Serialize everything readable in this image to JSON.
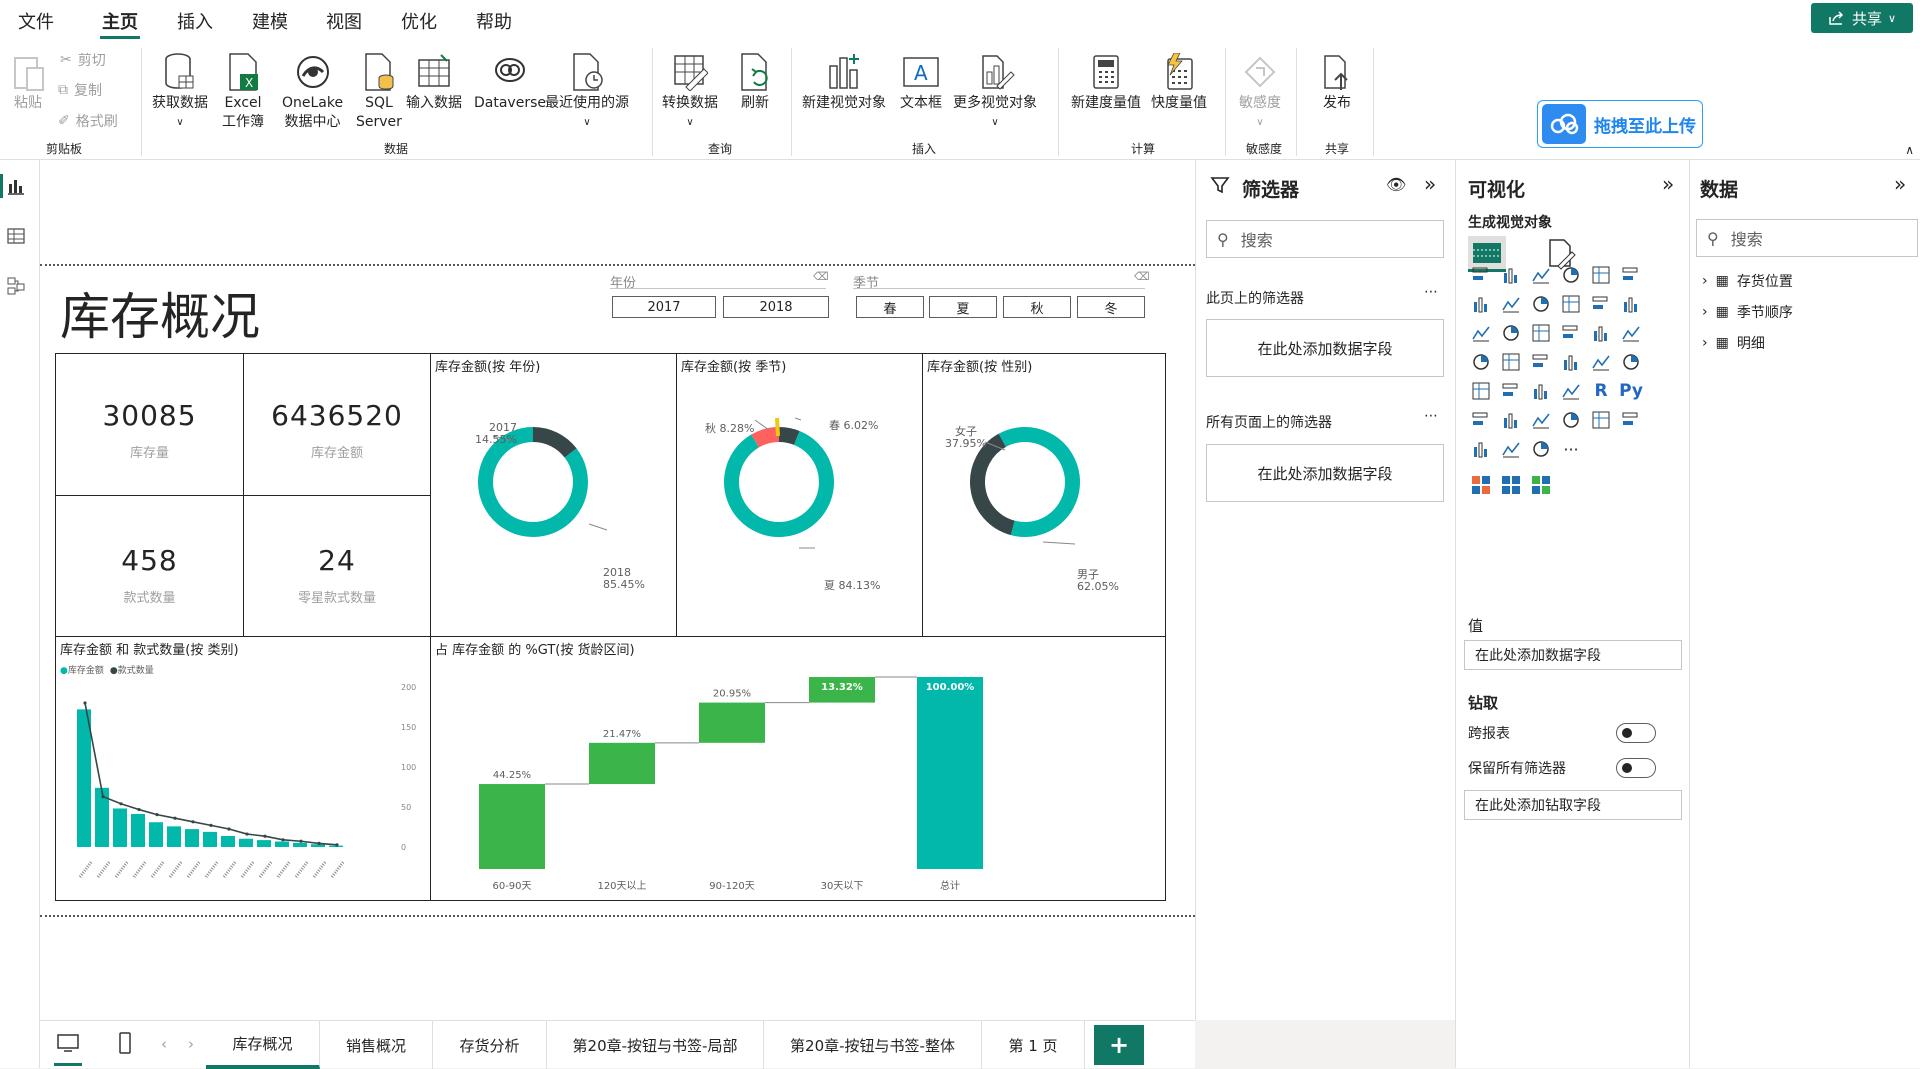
{
  "menu": [
    "文件",
    "主页",
    "插入",
    "建模",
    "视图",
    "优化",
    "帮助"
  ],
  "share": "共享",
  "ribbon": {
    "clipboard": {
      "paste": "粘贴",
      "cut": "剪切",
      "copy": "复制",
      "format": "格式刷",
      "label": "剪贴板"
    },
    "data": {
      "get_data": "获取数据",
      "excel": "Excel\n工作簿",
      "onelake": "OneLake\n数据中心",
      "sql": "SQL\nServer",
      "enter": "输入数据",
      "dataverse": "Dataverse",
      "recent": "最近使用的源",
      "label": "数据"
    },
    "query": {
      "transform": "转换数据",
      "refresh": "刷新",
      "label": "查询"
    },
    "insert": {
      "new_visual": "新建视觉对象",
      "textbox": "文本框",
      "more": "更多视觉对象",
      "label": "插入"
    },
    "calc": {
      "measure": "新建度量值",
      "quick": "快度量值",
      "label": "计算"
    },
    "sens": {
      "name": "敏感度",
      "label": "敏感度"
    },
    "share": {
      "publish": "发布",
      "label": "共享"
    },
    "upload": "拖拽至此上传"
  },
  "report": {
    "title": "库存概况",
    "slicer_year": {
      "label": "年份",
      "options": [
        "2017",
        "2018"
      ]
    },
    "slicer_season": {
      "label": "季节",
      "options": [
        "春",
        "夏",
        "秋",
        "冬"
      ]
    },
    "kpis": [
      {
        "value": "30085",
        "label": "库存量"
      },
      {
        "value": "6436520",
        "label": "库存金额"
      },
      {
        "value": "458",
        "label": "款式数量"
      },
      {
        "value": "24",
        "label": "零星款式数量"
      }
    ],
    "donut_year": {
      "title": "库存金额(按 年份)",
      "labels": [
        {
          "name": "2017",
          "pct": "14.55%"
        },
        {
          "name": "2018",
          "pct": "85.45%"
        }
      ]
    },
    "donut_season": {
      "title": "库存金额(按 季节)",
      "labels": [
        {
          "name": "秋",
          "pct": "8.28%"
        },
        {
          "name": "春",
          "pct": "6.02%"
        },
        {
          "name": "夏",
          "pct": "84.13%"
        }
      ]
    },
    "donut_gender": {
      "title": "库存金额(按 性别)",
      "labels": [
        {
          "name": "女子",
          "pct": "37.95%"
        },
        {
          "name": "男子",
          "pct": "62.05%"
        }
      ]
    },
    "combo_title": "库存金额 和 款式数量(按 类别)",
    "combo_legend": [
      "库存金额",
      "款式数量"
    ],
    "waterfall_title": "占 库存金额 的 %GT(按 货龄区间)"
  },
  "chart_data": [
    {
      "type": "pie",
      "title": "库存金额(按 年份)",
      "categories": [
        "2017",
        "2018"
      ],
      "values": [
        14.55,
        85.45
      ]
    },
    {
      "type": "pie",
      "title": "库存金额(按 季节)",
      "categories": [
        "秋",
        "春",
        "夏"
      ],
      "values": [
        8.28,
        6.02,
        84.13
      ]
    },
    {
      "type": "pie",
      "title": "库存金额(按 性别)",
      "categories": [
        "女子",
        "男子"
      ],
      "values": [
        37.95,
        62.05
      ]
    },
    {
      "type": "bar",
      "title": "库存金额 和 款式数量(按 类别)",
      "series": [
        {
          "name": "库存金额",
          "values": [
            100,
            43,
            28,
            24,
            18,
            15,
            13,
            11,
            8,
            6,
            5,
            4,
            3,
            2,
            1
          ]
        },
        {
          "name": "款式数量",
          "values": [
            200,
            70,
            60,
            52,
            45,
            40,
            35,
            30,
            25,
            18,
            15,
            10,
            8,
            5,
            3
          ]
        }
      ],
      "ylim": [
        0,
        200
      ],
      "yticks": [
        0,
        50,
        100,
        150,
        200
      ]
    },
    {
      "type": "bar",
      "title": "占 库存金额 的 %GT(按 货龄区间)",
      "categories": [
        "60-90天",
        "120天以上",
        "90-120天",
        "30天以下",
        "总计"
      ],
      "values": [
        44.25,
        21.47,
        20.95,
        13.32,
        100.0
      ],
      "labels": [
        "44.25%",
        "21.47%",
        "20.95%",
        "13.32%",
        "100.00%"
      ]
    }
  ],
  "filters": {
    "title": "筛选器",
    "search": "搜索",
    "page_label": "此页上的筛选器",
    "all_label": "所有页面上的筛选器",
    "add": "在此处添加数据字段"
  },
  "viz": {
    "title": "可视化",
    "sub": "生成视觉对象",
    "values": "值",
    "add": "在此处添加数据字段",
    "drill": "钻取",
    "cross": "跨报表",
    "keep": "保留所有筛选器",
    "drill_add": "在此处添加钻取字段",
    "r": "R",
    "py": "Py"
  },
  "data_pane": {
    "title": "数据",
    "search": "搜索",
    "items": [
      "存货位置",
      "季节顺序",
      "明细"
    ]
  },
  "tabs": [
    "库存概况",
    "销售概况",
    "存货分析",
    "第20章-按钮与书签-局部",
    "第20章-按钮与书签-整体",
    "第 1 页"
  ]
}
